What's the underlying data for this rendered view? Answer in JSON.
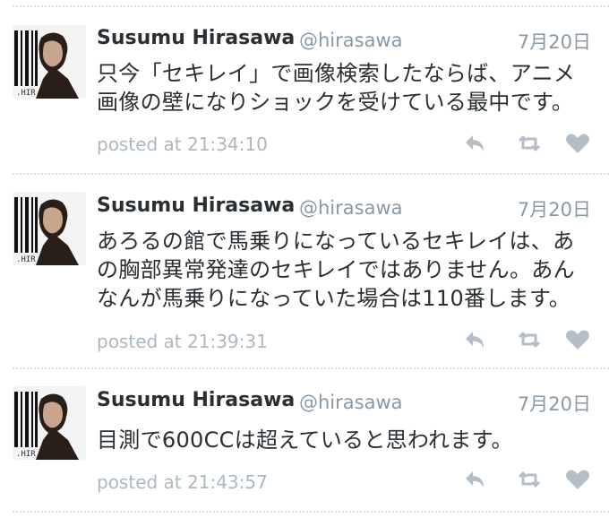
{
  "tweets": [
    {
      "author_name": "Susumu Hirasawa",
      "author_handle": "@hirasawa",
      "date": "7月20日",
      "lines": [
        "只今「セキレイ」で画像検索したならば、アニメ",
        "画像の壁になりショックを受けている最中です。"
      ],
      "posted_label": "posted at 21:34:10",
      "avatar_caption": ".HIR"
    },
    {
      "author_name": "Susumu Hirasawa",
      "author_handle": "@hirasawa",
      "date": "7月20日",
      "lines": [
        "あろるの館で馬乗りになっているセキレイは、あ",
        "の胸部異常発達のセキレイではありません。あん",
        "なんが馬乗りになっていた場合は110番します。"
      ],
      "posted_label": "posted at 21:39:31",
      "avatar_caption": ".HIR"
    },
    {
      "author_name": "Susumu Hirasawa",
      "author_handle": "@hirasawa",
      "date": "7月20日",
      "lines": [
        "目測で600CCは超えていると思われます。"
      ],
      "posted_label": "posted at 21:43:57",
      "avatar_caption": ".HIR"
    }
  ],
  "icons": {
    "reply": "reply-icon",
    "retweet": "retweet-icon",
    "favorite": "heart-icon"
  },
  "colors": {
    "name": "#292f33",
    "muted": "#8899a6",
    "meta": "#aab8c2",
    "icon": "#b4bec8",
    "divider": "#d9dde1"
  }
}
